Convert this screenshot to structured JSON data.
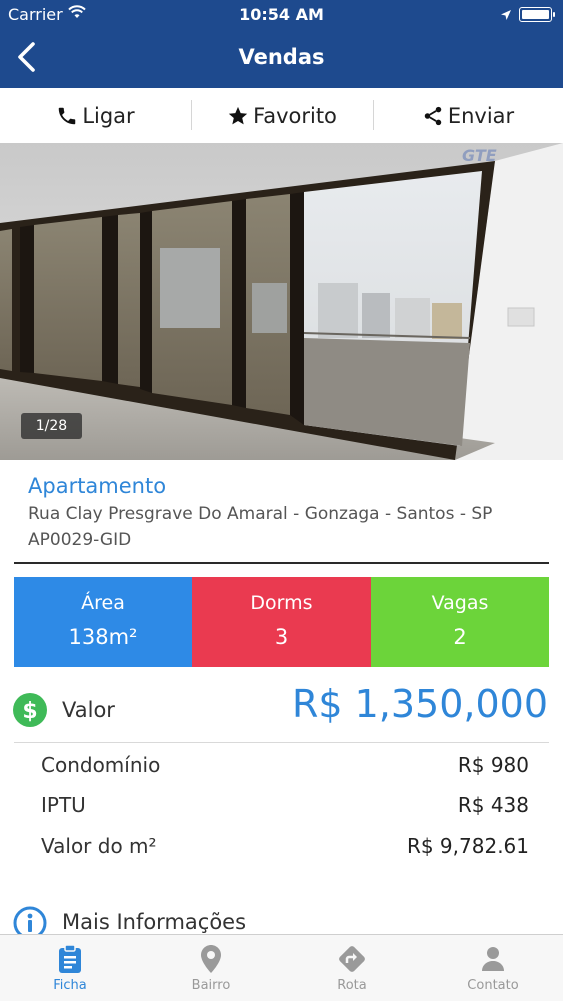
{
  "status_bar": {
    "carrier": "Carrier",
    "time": "10:54 AM"
  },
  "nav": {
    "title": "Vendas"
  },
  "actions": {
    "call": "Ligar",
    "favorite": "Favorito",
    "share": "Enviar"
  },
  "gallery": {
    "counter": "1/28"
  },
  "property": {
    "type": "Apartamento",
    "address": "Rua Clay Presgrave Do Amaral - Gonzaga - Santos - SP",
    "code": "AP0029-GID"
  },
  "stats": [
    {
      "label": "Área",
      "value": "138m²",
      "color": "#2e8ae6"
    },
    {
      "label": "Dorms",
      "value": "3",
      "color": "#ea3a50"
    },
    {
      "label": "Vagas",
      "value": "2",
      "color": "#6cd43a"
    }
  ],
  "valor": {
    "label": "Valor",
    "amount": "R$ 1,350,000"
  },
  "costs": [
    {
      "label": "Condomínio",
      "value": "R$ 980"
    },
    {
      "label": "IPTU",
      "value": "R$ 438"
    },
    {
      "label": "Valor do m²",
      "value": "R$ 9,782.61"
    }
  ],
  "more_info": {
    "label": "Mais Informações"
  },
  "tabs": [
    {
      "label": "Ficha",
      "icon": "clipboard-icon",
      "active": true
    },
    {
      "label": "Bairro",
      "icon": "map-pin-icon",
      "active": false
    },
    {
      "label": "Rota",
      "icon": "route-icon",
      "active": false
    },
    {
      "label": "Contato",
      "icon": "person-icon",
      "active": false
    }
  ],
  "colors": {
    "header": "#1e4a8e",
    "accent": "#2f86d8",
    "money_icon": "#3fba58"
  }
}
